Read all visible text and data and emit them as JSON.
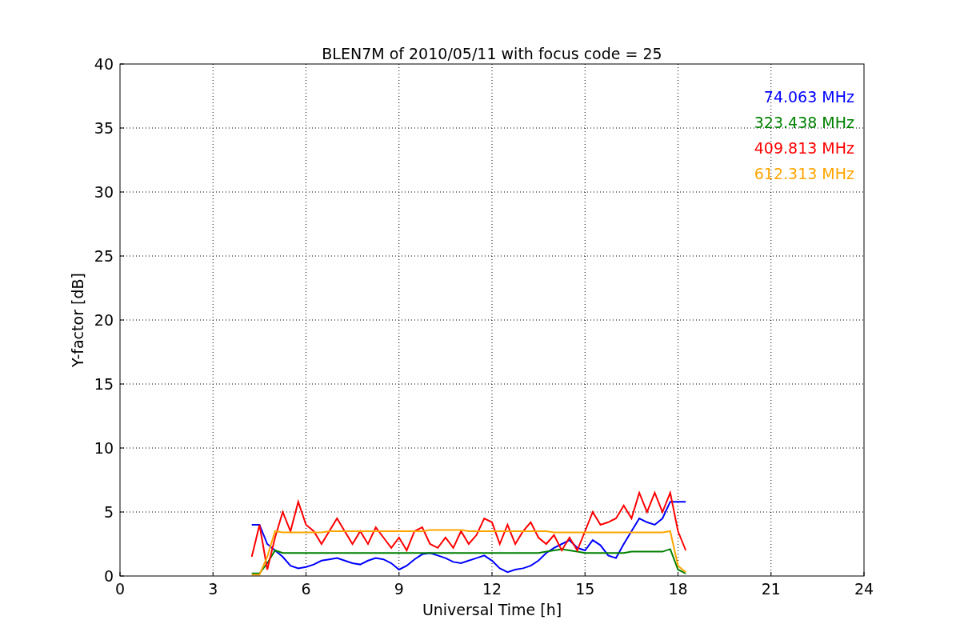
{
  "chart_data": {
    "type": "line",
    "title": "BLEN7M of 2010/05/11 with focus code = 25",
    "xlabel": "Universal Time [h]",
    "ylabel": "Y-factor [dB]",
    "x": [
      4.25,
      4.5,
      4.75,
      5,
      5.25,
      5.5,
      5.75,
      6,
      6.25,
      6.5,
      6.75,
      7,
      7.25,
      7.5,
      7.75,
      8,
      8.25,
      8.5,
      8.75,
      9,
      9.25,
      9.5,
      9.75,
      10,
      10.25,
      10.5,
      10.75,
      11,
      11.25,
      11.5,
      11.75,
      12,
      12.25,
      12.5,
      12.75,
      13,
      13.25,
      13.5,
      13.75,
      14,
      14.25,
      14.5,
      14.75,
      15,
      15.25,
      15.5,
      15.75,
      16,
      16.25,
      16.5,
      16.75,
      17,
      17.25,
      17.5,
      17.75,
      18,
      18.25
    ],
    "series": [
      {
        "name": "74.063 MHz",
        "color": "#0000ff",
        "values": [
          4.0,
          4.0,
          2.5,
          2.0,
          1.5,
          0.8,
          0.6,
          0.7,
          0.9,
          1.2,
          1.3,
          1.4,
          1.2,
          1.0,
          0.9,
          1.2,
          1.4,
          1.3,
          1.0,
          0.5,
          0.8,
          1.3,
          1.7,
          1.8,
          1.6,
          1.4,
          1.1,
          1.0,
          1.2,
          1.4,
          1.6,
          1.2,
          0.6,
          0.3,
          0.5,
          0.6,
          0.8,
          1.2,
          1.8,
          2.2,
          2.5,
          2.8,
          2.2,
          2.0,
          2.8,
          2.4,
          1.6,
          1.4,
          2.5,
          3.5,
          4.5,
          4.2,
          4.0,
          4.5,
          5.8,
          5.8,
          5.8
        ]
      },
      {
        "name": "323.438 MHz",
        "color": "#008000",
        "values": [
          0.2,
          0.2,
          1.0,
          2.0,
          1.8,
          1.8,
          1.8,
          1.8,
          1.8,
          1.8,
          1.8,
          1.8,
          1.8,
          1.8,
          1.8,
          1.8,
          1.8,
          1.8,
          1.8,
          1.8,
          1.8,
          1.8,
          1.8,
          1.8,
          1.8,
          1.8,
          1.8,
          1.8,
          1.8,
          1.8,
          1.8,
          1.8,
          1.8,
          1.8,
          1.8,
          1.8,
          1.8,
          1.8,
          1.9,
          2.0,
          2.1,
          2.0,
          1.9,
          1.8,
          1.8,
          1.8,
          1.8,
          1.8,
          1.8,
          1.9,
          1.9,
          1.9,
          1.9,
          1.9,
          2.1,
          0.5,
          0.2
        ]
      },
      {
        "name": "409.813 MHz",
        "color": "#ff0000",
        "values": [
          1.5,
          4.0,
          0.5,
          3.0,
          5.0,
          3.5,
          5.8,
          4.0,
          3.5,
          2.5,
          3.5,
          4.5,
          3.5,
          2.5,
          3.5,
          2.5,
          3.8,
          3.0,
          2.2,
          3.0,
          2.0,
          3.5,
          3.8,
          2.5,
          2.2,
          3.0,
          2.2,
          3.5,
          2.5,
          3.2,
          4.5,
          4.2,
          2.5,
          4.0,
          2.5,
          3.5,
          4.2,
          3.0,
          2.5,
          3.2,
          2.0,
          3.0,
          2.0,
          3.5,
          5.0,
          4.0,
          4.2,
          4.5,
          5.5,
          4.5,
          6.5,
          5.0,
          6.5,
          5.0,
          6.5,
          3.5,
          2.0
        ]
      },
      {
        "name": "612.313 MHz",
        "color": "#ffa500",
        "values": [
          0.1,
          0.1,
          1.5,
          3.5,
          3.4,
          3.4,
          3.4,
          3.4,
          3.4,
          3.4,
          3.5,
          3.5,
          3.5,
          3.5,
          3.5,
          3.5,
          3.5,
          3.5,
          3.5,
          3.5,
          3.5,
          3.5,
          3.5,
          3.6,
          3.6,
          3.6,
          3.6,
          3.6,
          3.5,
          3.5,
          3.5,
          3.5,
          3.5,
          3.5,
          3.5,
          3.5,
          3.5,
          3.5,
          3.5,
          3.4,
          3.4,
          3.4,
          3.4,
          3.4,
          3.4,
          3.4,
          3.4,
          3.4,
          3.4,
          3.4,
          3.4,
          3.4,
          3.4,
          3.4,
          3.5,
          0.8,
          0.3
        ]
      }
    ],
    "grid": true,
    "xlim": [
      0,
      24
    ],
    "ylim": [
      0,
      40
    ],
    "xticks": [
      0,
      3,
      6,
      9,
      12,
      15,
      18,
      21,
      24
    ],
    "yticks": [
      0,
      5,
      10,
      15,
      20,
      25,
      30,
      35,
      40
    ]
  }
}
